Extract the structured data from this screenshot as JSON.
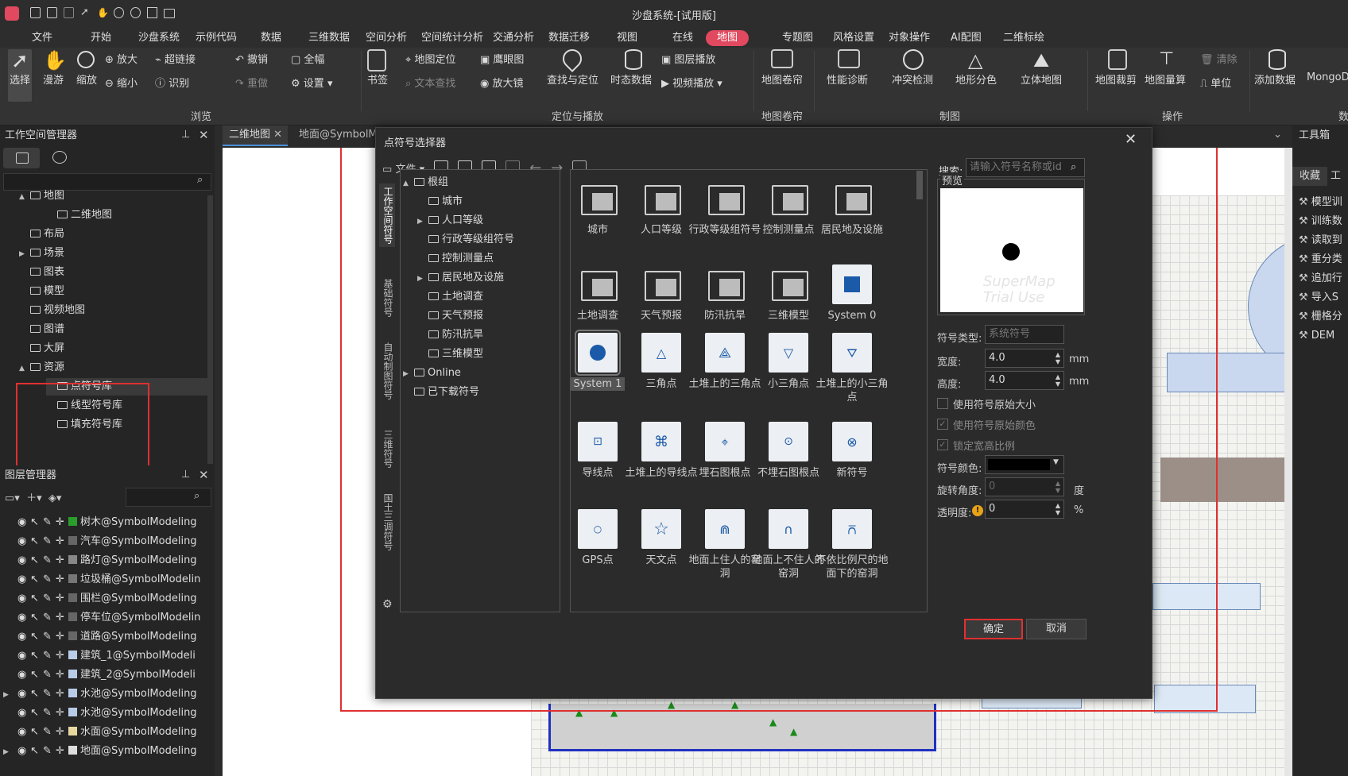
{
  "titlebar": {
    "title": "沙盘系统-[试用版]"
  },
  "menu": [
    "文件",
    "开始",
    "沙盘系统",
    "示例代码",
    "数据",
    "三维数据",
    "空间分析",
    "空间统计分析",
    "交通分析",
    "数据迁移",
    "视图",
    "在线",
    "地图",
    "专题图",
    "风格设置",
    "对象操作",
    "AI配图",
    "二维标绘"
  ],
  "ribbon": {
    "select": "选择",
    "pan": "漫游",
    "zoom": "缩放",
    "zoom_in": "放大",
    "zoom_out": "缩小",
    "hyperlink": "超链接",
    "identify": "识别",
    "undo": "撤销",
    "redo": "重做",
    "full": "全幅",
    "settings": "设置",
    "bookmark": "书签",
    "map_locate": "地图定位",
    "text_find": "文本查找",
    "eagle": "鹰眼图",
    "magnifier": "放大镜",
    "find_locate": "查找与定位",
    "temporal": "时态数据",
    "layer_play": "图层播放",
    "video_play": "视频播放",
    "map_scroll": "地图卷帘",
    "perf": "性能诊断",
    "conflict": "冲突检测",
    "terrain": "地形分色",
    "stereo": "立体地图",
    "map_clip": "地图裁剪",
    "map_measure": "地图量算",
    "clear": "清除",
    "unit": "单位",
    "add_data": "添加数据",
    "mongo": "MongoD",
    "groups": {
      "browse": "浏览",
      "locate_play": "定位与播放",
      "scroll": "地图卷帘",
      "mapping": "制图",
      "operation": "操作",
      "data": "数"
    }
  },
  "workspace": {
    "title": "工作空间管理器",
    "tree": [
      {
        "label": "地图",
        "indent": 0,
        "arrow": "▲"
      },
      {
        "label": "二维地图",
        "indent": 1,
        "arrow": ""
      },
      {
        "label": "布局",
        "indent": 0,
        "arrow": ""
      },
      {
        "label": "场景",
        "indent": 0,
        "arrow": "▶"
      },
      {
        "label": "图表",
        "indent": 0,
        "arrow": ""
      },
      {
        "label": "模型",
        "indent": 0,
        "arrow": ""
      },
      {
        "label": "视频地图",
        "indent": 0,
        "arrow": ""
      },
      {
        "label": "图谱",
        "indent": 0,
        "arrow": ""
      },
      {
        "label": "大屏",
        "indent": 0,
        "arrow": ""
      },
      {
        "label": "资源",
        "indent": 0,
        "arrow": "▲"
      },
      {
        "label": "点符号库",
        "indent": 1,
        "arrow": ""
      },
      {
        "label": "线型符号库",
        "indent": 1,
        "arrow": ""
      },
      {
        "label": "填充符号库",
        "indent": 1,
        "arrow": ""
      }
    ]
  },
  "layers": {
    "title": "图层管理器",
    "rows": [
      "树木@SymbolModeling",
      "汽车@SymbolModeling",
      "路灯@SymbolModeling",
      "垃圾桶@SymbolModelin",
      "围栏@SymbolModeling",
      "停车位@SymbolModelin",
      "道路@SymbolModeling",
      "建筑_1@SymbolModeli",
      "建筑_2@SymbolModeli",
      "水池@SymbolModeling",
      "水池@SymbolModeling",
      "水面@SymbolModeling",
      "地面@SymbolModeling"
    ]
  },
  "tabs": {
    "map2d": "二维地图",
    "ground": "地面@SymbolM"
  },
  "toolbox": {
    "title": "工具箱",
    "tab_fav": "收藏",
    "tab_tools": "工",
    "items": [
      "模型训",
      "训练数",
      "读取到",
      "重分类",
      "追加行",
      "导入S",
      "栅格分",
      "DEM"
    ]
  },
  "dialog": {
    "title": "点符号选择器",
    "file_menu": "文件",
    "search_label": "搜索:",
    "search_placeholder": "请输入符号名称或id",
    "side_tabs": [
      "工作空间符号",
      "基础符号",
      "自动制图符号",
      "三维符号",
      "国土三调符号"
    ],
    "tree": [
      {
        "label": "根组",
        "indent": 0,
        "arrow": "▲"
      },
      {
        "label": "城市",
        "indent": 1,
        "arrow": ""
      },
      {
        "label": "人口等级",
        "indent": 1,
        "arrow": "▶"
      },
      {
        "label": "行政等级组符号",
        "indent": 1,
        "arrow": ""
      },
      {
        "label": "控制测量点",
        "indent": 1,
        "arrow": ""
      },
      {
        "label": "居民地及设施",
        "indent": 1,
        "arrow": "▶"
      },
      {
        "label": "土地调查",
        "indent": 1,
        "arrow": ""
      },
      {
        "label": "天气预报",
        "indent": 1,
        "arrow": ""
      },
      {
        "label": "防汛抗旱",
        "indent": 1,
        "arrow": ""
      },
      {
        "label": "三维模型",
        "indent": 1,
        "arrow": ""
      },
      {
        "label": "Online",
        "indent": 0,
        "arrow": "▶"
      },
      {
        "label": "已下载符号",
        "indent": 0,
        "arrow": ""
      }
    ],
    "symbols": [
      {
        "label": "城市",
        "icon": "folder"
      },
      {
        "label": "人口等级",
        "icon": "folder"
      },
      {
        "label": "行政等级组符号",
        "icon": "folder"
      },
      {
        "label": "控制测量点",
        "icon": "folder"
      },
      {
        "label": "居民地及设施",
        "icon": "folder"
      },
      {
        "label": "土地调查",
        "icon": "folder"
      },
      {
        "label": "天气预报",
        "icon": "folder"
      },
      {
        "label": "防汛抗旱",
        "icon": "folder"
      },
      {
        "label": "三维模型",
        "icon": "folder"
      },
      {
        "label": "System 0",
        "icon": "square"
      },
      {
        "label": "System 1",
        "icon": "circle"
      },
      {
        "label": "三角点",
        "icon": "tri"
      },
      {
        "label": "土堆上的三角点",
        "icon": "tri-mound"
      },
      {
        "label": "小三角点",
        "icon": "tri-down"
      },
      {
        "label": "土堆上的小三角点",
        "icon": "tri-down-mound"
      },
      {
        "label": "导线点",
        "icon": "sq-dot"
      },
      {
        "label": "土堆上的导线点",
        "icon": "chip"
      },
      {
        "label": "埋石图根点",
        "icon": "cross-circle"
      },
      {
        "label": "不埋石图根点",
        "icon": "dot-circle"
      },
      {
        "label": "新符号",
        "icon": "x-circle"
      },
      {
        "label": "GPS点",
        "icon": "small-circle"
      },
      {
        "label": "天文点",
        "icon": "star"
      },
      {
        "label": "地面上住人的窑洞",
        "icon": "arch"
      },
      {
        "label": "地面上不住人的窑洞",
        "icon": "arch2"
      },
      {
        "label": "不依比例尺的地面下的窑洞",
        "icon": "arch3"
      }
    ],
    "preview_label": "预览",
    "watermark": "SuperMap Trial Use",
    "props": {
      "type_label": "符号类型:",
      "type_value": "系统符号",
      "width_label": "宽度:",
      "width_value": "4.0",
      "width_unit": "mm",
      "height_label": "高度:",
      "height_value": "4.0",
      "height_unit": "mm",
      "orig_size": "使用符号原始大小",
      "orig_color": "使用符号原始颜色",
      "lock_ratio": "锁定宽高比例",
      "color_label": "符号颜色:",
      "rot_label": "旋转角度:",
      "rot_value": "0",
      "rot_unit": "度",
      "alpha_label": "透明度:",
      "alpha_value": "0",
      "alpha_unit": "%"
    },
    "ok": "确定",
    "cancel": "取消"
  },
  "colors": {
    "accent": "#e0495f",
    "symbol_blue": "#1a5aa8",
    "highlight_red": "#e03030"
  }
}
